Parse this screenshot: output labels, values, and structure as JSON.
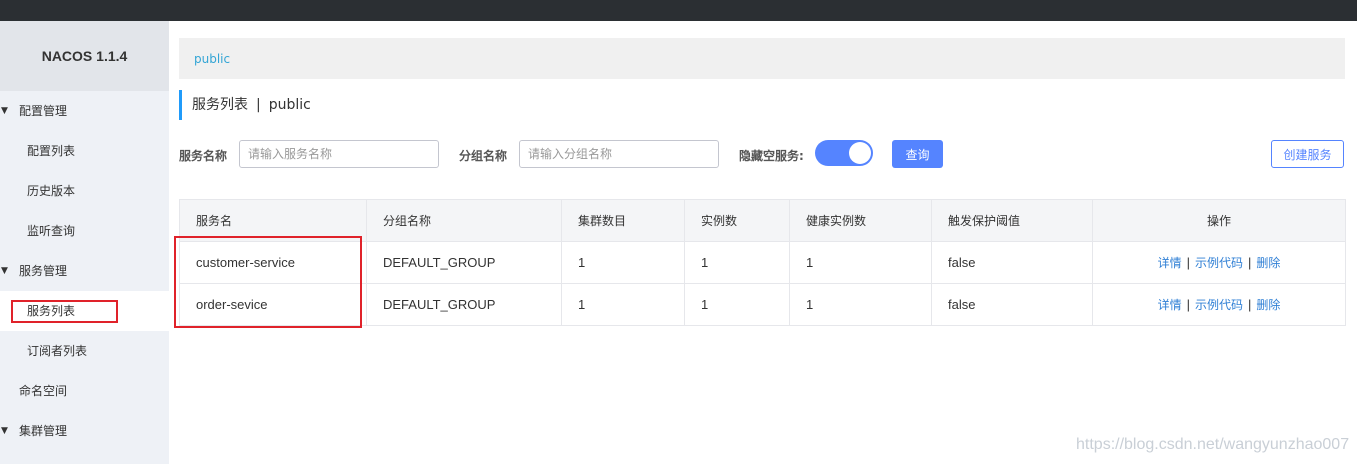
{
  "app": {
    "title": "NACOS 1.1.4"
  },
  "sidebar": {
    "items": [
      {
        "label": "配置管理",
        "type": "group",
        "expanded": true
      },
      {
        "label": "配置列表",
        "type": "sub"
      },
      {
        "label": "历史版本",
        "type": "sub"
      },
      {
        "label": "监听查询",
        "type": "sub"
      },
      {
        "label": "服务管理",
        "type": "group",
        "expanded": true
      },
      {
        "label": "服务列表",
        "type": "sub",
        "active": true
      },
      {
        "label": "订阅者列表",
        "type": "sub"
      },
      {
        "label": "命名空间",
        "type": "item"
      },
      {
        "label": "集群管理",
        "type": "group",
        "expanded": true
      }
    ]
  },
  "namespace_bar": {
    "label": "public"
  },
  "page": {
    "title": "服务列表",
    "separator": "|",
    "namespace": "public"
  },
  "search": {
    "service_name_label": "服务名称",
    "service_name_placeholder": "请输入服务名称",
    "group_name_label": "分组名称",
    "group_name_placeholder": "请输入分组名称",
    "hide_empty_label": "隐藏空服务:",
    "hide_empty_on": true,
    "query_button": "查询",
    "create_button": "创建服务"
  },
  "table": {
    "columns": [
      "服务名",
      "分组名称",
      "集群数目",
      "实例数",
      "健康实例数",
      "触发保护阈值",
      "操作"
    ],
    "rows": [
      {
        "service": "customer-service",
        "group": "DEFAULT_GROUP",
        "clusters": "1",
        "instances": "1",
        "healthy": "1",
        "threshold": "false"
      },
      {
        "service": "order-sevice",
        "group": "DEFAULT_GROUP",
        "clusters": "1",
        "instances": "1",
        "healthy": "1",
        "threshold": "false"
      }
    ],
    "actions": {
      "detail": "详情",
      "sample_code": "示例代码",
      "delete": "删除",
      "separator": "|"
    }
  },
  "watermark": "https://blog.csdn.net/wangyunzhao007",
  "colors": {
    "accent": "#5584ff",
    "link": "#2f7fd5",
    "highlight": "#e0222a",
    "namespace": "#33a5d5"
  }
}
